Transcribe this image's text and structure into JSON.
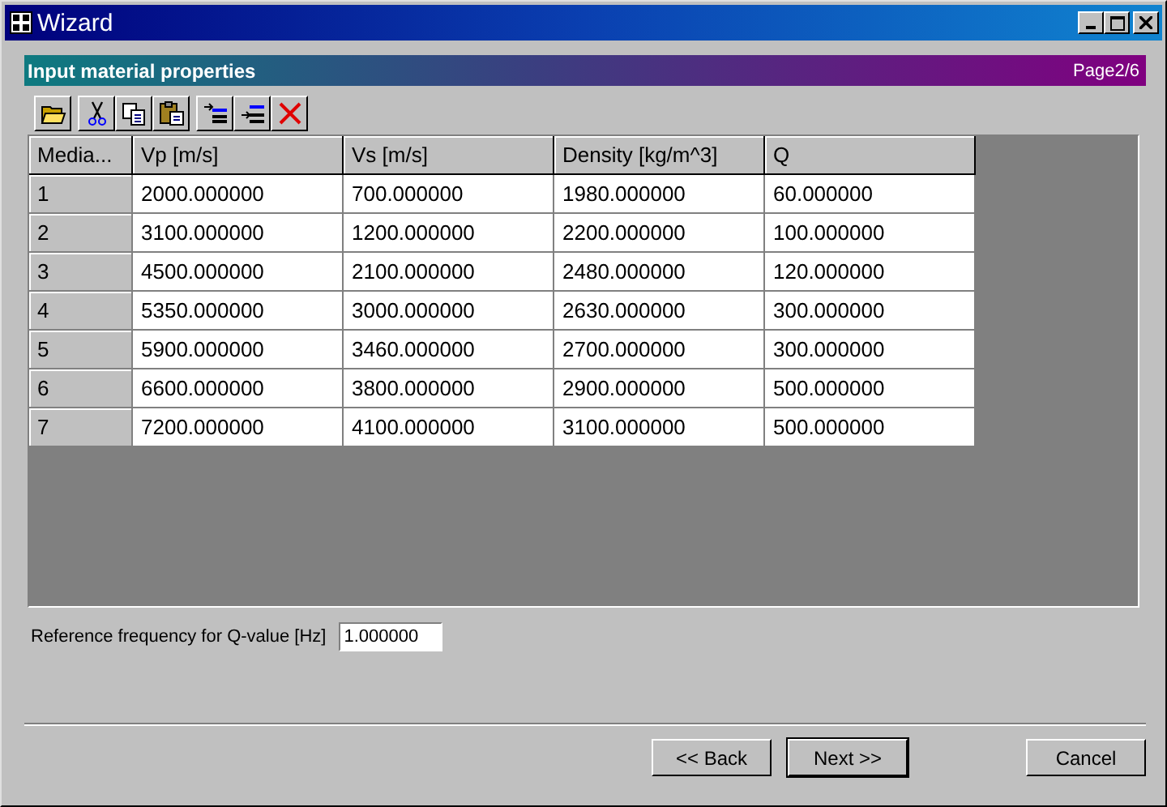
{
  "window": {
    "title": "Wizard"
  },
  "banner": {
    "title": "Input material properties",
    "page": "Page2/6"
  },
  "toolbar": [
    {
      "kind": "open"
    },
    {
      "kind": "cut"
    },
    {
      "kind": "copy"
    },
    {
      "kind": "paste"
    },
    {
      "kind": "insert"
    },
    {
      "kind": "append"
    },
    {
      "kind": "delete"
    }
  ],
  "table": {
    "columns": [
      "Media...",
      "Vp [m/s]",
      "Vs [m/s]",
      "Density [kg/m^3]",
      "Q"
    ],
    "rows": [
      [
        "1",
        "2000.000000",
        "700.000000",
        "1980.000000",
        "60.000000"
      ],
      [
        "2",
        "3100.000000",
        "1200.000000",
        "2200.000000",
        "100.000000"
      ],
      [
        "3",
        "4500.000000",
        "2100.000000",
        "2480.000000",
        "120.000000"
      ],
      [
        "4",
        "5350.000000",
        "3000.000000",
        "2630.000000",
        "300.000000"
      ],
      [
        "5",
        "5900.000000",
        "3460.000000",
        "2700.000000",
        "300.000000"
      ],
      [
        "6",
        "6600.000000",
        "3800.000000",
        "2900.000000",
        "500.000000"
      ],
      [
        "7",
        "7200.000000",
        "4100.000000",
        "3100.000000",
        "500.000000"
      ]
    ]
  },
  "reference_frequency": {
    "label": "Reference frequency for Q-value [Hz]",
    "value": "1.000000"
  },
  "buttons": [
    {
      "label": "<< Back",
      "default": false
    },
    {
      "label": "Next >>",
      "default": true
    },
    {
      "label": "Cancel",
      "default": false
    }
  ]
}
